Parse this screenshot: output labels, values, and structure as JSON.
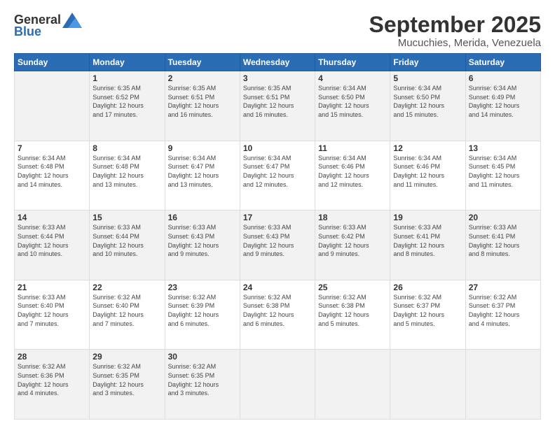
{
  "logo": {
    "line1": "General",
    "line2": "Blue"
  },
  "title": "September 2025",
  "subtitle": "Mucuchies, Merida, Venezuela",
  "days_header": [
    "Sunday",
    "Monday",
    "Tuesday",
    "Wednesday",
    "Thursday",
    "Friday",
    "Saturday"
  ],
  "weeks": [
    [
      {
        "day": "",
        "info": ""
      },
      {
        "day": "1",
        "info": "Sunrise: 6:35 AM\nSunset: 6:52 PM\nDaylight: 12 hours\nand 17 minutes."
      },
      {
        "day": "2",
        "info": "Sunrise: 6:35 AM\nSunset: 6:51 PM\nDaylight: 12 hours\nand 16 minutes."
      },
      {
        "day": "3",
        "info": "Sunrise: 6:35 AM\nSunset: 6:51 PM\nDaylight: 12 hours\nand 16 minutes."
      },
      {
        "day": "4",
        "info": "Sunrise: 6:34 AM\nSunset: 6:50 PM\nDaylight: 12 hours\nand 15 minutes."
      },
      {
        "day": "5",
        "info": "Sunrise: 6:34 AM\nSunset: 6:50 PM\nDaylight: 12 hours\nand 15 minutes."
      },
      {
        "day": "6",
        "info": "Sunrise: 6:34 AM\nSunset: 6:49 PM\nDaylight: 12 hours\nand 14 minutes."
      }
    ],
    [
      {
        "day": "7",
        "info": "Sunrise: 6:34 AM\nSunset: 6:48 PM\nDaylight: 12 hours\nand 14 minutes."
      },
      {
        "day": "8",
        "info": "Sunrise: 6:34 AM\nSunset: 6:48 PM\nDaylight: 12 hours\nand 13 minutes."
      },
      {
        "day": "9",
        "info": "Sunrise: 6:34 AM\nSunset: 6:47 PM\nDaylight: 12 hours\nand 13 minutes."
      },
      {
        "day": "10",
        "info": "Sunrise: 6:34 AM\nSunset: 6:47 PM\nDaylight: 12 hours\nand 12 minutes."
      },
      {
        "day": "11",
        "info": "Sunrise: 6:34 AM\nSunset: 6:46 PM\nDaylight: 12 hours\nand 12 minutes."
      },
      {
        "day": "12",
        "info": "Sunrise: 6:34 AM\nSunset: 6:46 PM\nDaylight: 12 hours\nand 11 minutes."
      },
      {
        "day": "13",
        "info": "Sunrise: 6:34 AM\nSunset: 6:45 PM\nDaylight: 12 hours\nand 11 minutes."
      }
    ],
    [
      {
        "day": "14",
        "info": "Sunrise: 6:33 AM\nSunset: 6:44 PM\nDaylight: 12 hours\nand 10 minutes."
      },
      {
        "day": "15",
        "info": "Sunrise: 6:33 AM\nSunset: 6:44 PM\nDaylight: 12 hours\nand 10 minutes."
      },
      {
        "day": "16",
        "info": "Sunrise: 6:33 AM\nSunset: 6:43 PM\nDaylight: 12 hours\nand 9 minutes."
      },
      {
        "day": "17",
        "info": "Sunrise: 6:33 AM\nSunset: 6:43 PM\nDaylight: 12 hours\nand 9 minutes."
      },
      {
        "day": "18",
        "info": "Sunrise: 6:33 AM\nSunset: 6:42 PM\nDaylight: 12 hours\nand 9 minutes."
      },
      {
        "day": "19",
        "info": "Sunrise: 6:33 AM\nSunset: 6:41 PM\nDaylight: 12 hours\nand 8 minutes."
      },
      {
        "day": "20",
        "info": "Sunrise: 6:33 AM\nSunset: 6:41 PM\nDaylight: 12 hours\nand 8 minutes."
      }
    ],
    [
      {
        "day": "21",
        "info": "Sunrise: 6:33 AM\nSunset: 6:40 PM\nDaylight: 12 hours\nand 7 minutes."
      },
      {
        "day": "22",
        "info": "Sunrise: 6:32 AM\nSunset: 6:40 PM\nDaylight: 12 hours\nand 7 minutes."
      },
      {
        "day": "23",
        "info": "Sunrise: 6:32 AM\nSunset: 6:39 PM\nDaylight: 12 hours\nand 6 minutes."
      },
      {
        "day": "24",
        "info": "Sunrise: 6:32 AM\nSunset: 6:38 PM\nDaylight: 12 hours\nand 6 minutes."
      },
      {
        "day": "25",
        "info": "Sunrise: 6:32 AM\nSunset: 6:38 PM\nDaylight: 12 hours\nand 5 minutes."
      },
      {
        "day": "26",
        "info": "Sunrise: 6:32 AM\nSunset: 6:37 PM\nDaylight: 12 hours\nand 5 minutes."
      },
      {
        "day": "27",
        "info": "Sunrise: 6:32 AM\nSunset: 6:37 PM\nDaylight: 12 hours\nand 4 minutes."
      }
    ],
    [
      {
        "day": "28",
        "info": "Sunrise: 6:32 AM\nSunset: 6:36 PM\nDaylight: 12 hours\nand 4 minutes."
      },
      {
        "day": "29",
        "info": "Sunrise: 6:32 AM\nSunset: 6:35 PM\nDaylight: 12 hours\nand 3 minutes."
      },
      {
        "day": "30",
        "info": "Sunrise: 6:32 AM\nSunset: 6:35 PM\nDaylight: 12 hours\nand 3 minutes."
      },
      {
        "day": "",
        "info": ""
      },
      {
        "day": "",
        "info": ""
      },
      {
        "day": "",
        "info": ""
      },
      {
        "day": "",
        "info": ""
      }
    ]
  ]
}
